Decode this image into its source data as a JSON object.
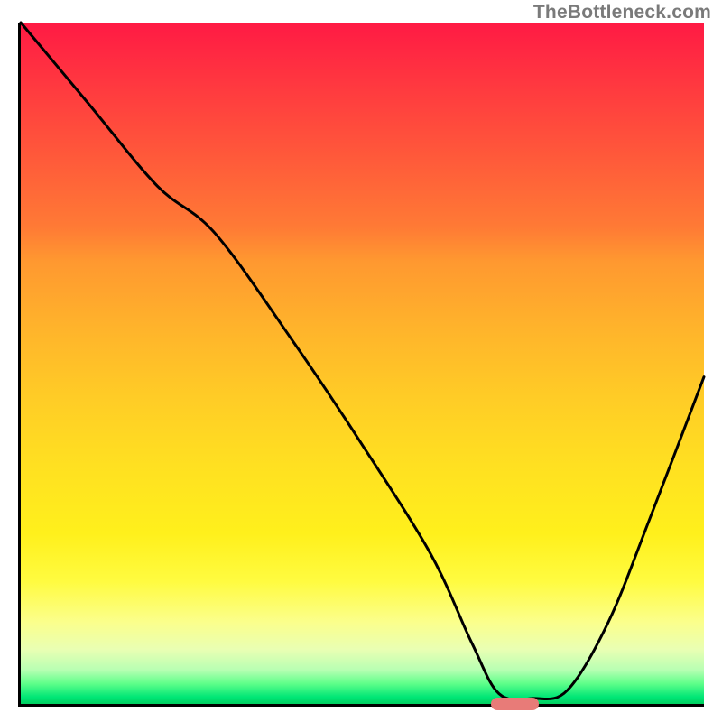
{
  "attribution": "TheBottleneck.com",
  "colors": {
    "gradient_top": "#ff1a44",
    "gradient_mid": "#ffe021",
    "gradient_bottom": "#00cf5f",
    "curve": "#000000",
    "axis": "#000000",
    "marker": "#e87b78"
  },
  "chart_data": {
    "type": "line",
    "title": "",
    "xlabel": "",
    "ylabel": "",
    "xlim": [
      0,
      100
    ],
    "ylim": [
      0,
      100
    ],
    "grid": false,
    "annotations": [],
    "marker": {
      "x": 72,
      "y": 0,
      "width": 7
    },
    "series": [
      {
        "name": "bottleneck-curve",
        "x": [
          0,
          10,
          20,
          28.5,
          40,
          50,
          60,
          66,
          70,
          75,
          80,
          86,
          92,
          100
        ],
        "values": [
          100,
          88,
          76,
          69,
          53,
          38,
          22,
          9,
          1.5,
          0.8,
          2,
          12,
          27,
          48
        ]
      }
    ]
  }
}
